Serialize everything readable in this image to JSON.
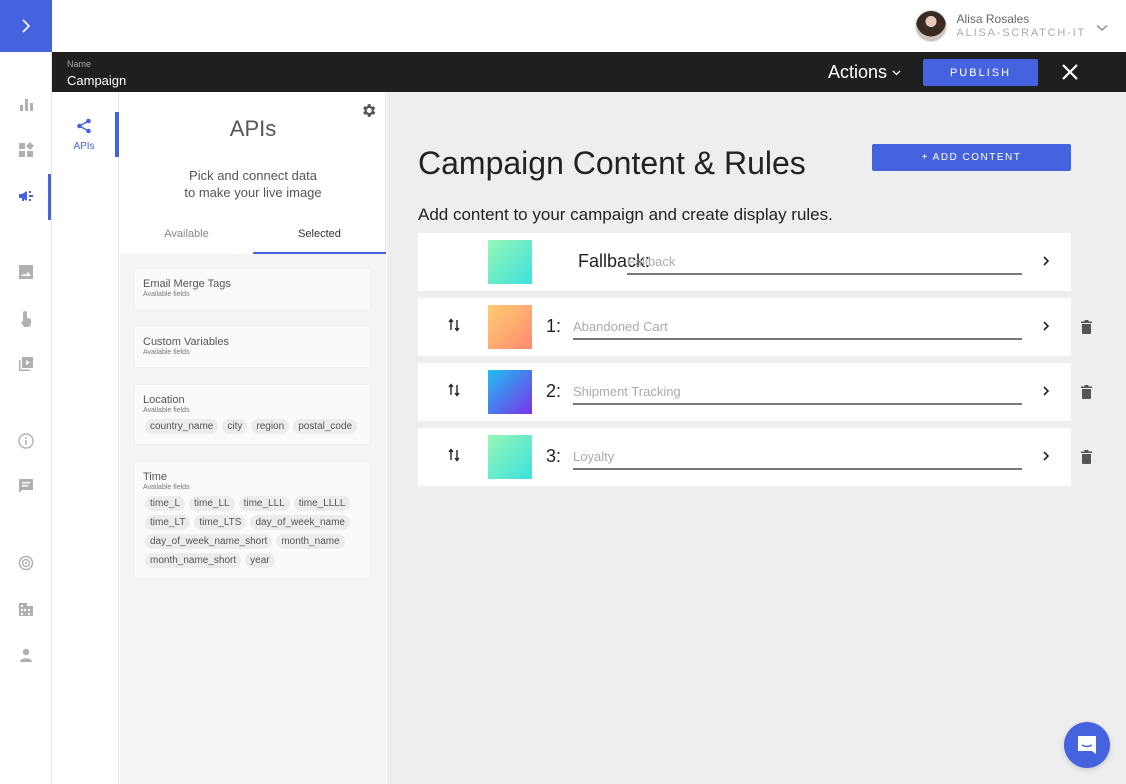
{
  "rail": {
    "toggle_icon": "chevron-right-icon",
    "items": [
      {
        "icon": "bar-chart-icon",
        "active": false
      },
      {
        "icon": "widgets-icon",
        "active": false
      },
      {
        "icon": "campaign-megaphone-icon",
        "active": true
      },
      {
        "icon": "image-icon",
        "active": false
      },
      {
        "icon": "touch-icon",
        "active": false
      },
      {
        "icon": "video-library-icon",
        "active": false
      },
      {
        "icon": "info-icon",
        "active": false
      },
      {
        "icon": "comment-icon",
        "active": false
      },
      {
        "icon": "radar-icon",
        "active": false
      },
      {
        "icon": "building-icon",
        "active": false
      },
      {
        "icon": "person-icon",
        "active": false
      }
    ]
  },
  "user": {
    "name": "Alisa Rosales",
    "org": "ALISA-SCRATCH-IT"
  },
  "header": {
    "name_label": "Name",
    "name_value": "Campaign",
    "actions_label": "Actions",
    "publish_label": "PUBLISH"
  },
  "subnav": {
    "item_label": "APIs"
  },
  "api_panel": {
    "title": "APIs",
    "desc_line1": "Pick and connect data",
    "desc_line2": "to make your live image",
    "tabs": [
      {
        "label": "Available",
        "active": false
      },
      {
        "label": "Selected",
        "active": true
      }
    ],
    "cards": [
      {
        "title": "Email Merge Tags",
        "sub": "Available fields",
        "chips": []
      },
      {
        "title": "Custom Variables",
        "sub": "Available fields",
        "chips": []
      },
      {
        "title": "Location",
        "sub": "Available fields",
        "chips": [
          "country_name",
          "city",
          "region",
          "postal_code"
        ]
      },
      {
        "title": "Time",
        "sub": "Available fields",
        "chips": [
          "time_L",
          "time_LL",
          "time_LLL",
          "time_LLLL",
          "time_LT",
          "time_LTS",
          "day_of_week_name",
          "day_of_week_name_short",
          "month_name",
          "month_name_short",
          "year"
        ]
      }
    ]
  },
  "main": {
    "title": "Campaign Content & Rules",
    "add_content_label": "+ ADD CONTENT",
    "subtitle": "Add content to your campaign and create display rules.",
    "rules": [
      {
        "label": "Fallback:",
        "placeholder": "Fallback",
        "draggable": false,
        "deletable": false,
        "gradient": [
          "#96f7b6",
          "#3ee0dc"
        ]
      },
      {
        "label": "1:",
        "placeholder": "Abandoned Cart",
        "draggable": true,
        "deletable": true,
        "gradient": [
          "#ffcc70",
          "#ff8a72"
        ]
      },
      {
        "label": "2:",
        "placeholder": "Shipment Tracking",
        "draggable": true,
        "deletable": true,
        "gradient": [
          "#1fc0f2",
          "#7a33e6"
        ]
      },
      {
        "label": "3:",
        "placeholder": "Loyalty",
        "draggable": true,
        "deletable": true,
        "gradient": [
          "#96f7b6",
          "#3ee0dc"
        ]
      }
    ]
  },
  "colors": {
    "accent": "#4562df",
    "header_bg": "#1f1f1f",
    "main_bg": "#eeeeee"
  }
}
